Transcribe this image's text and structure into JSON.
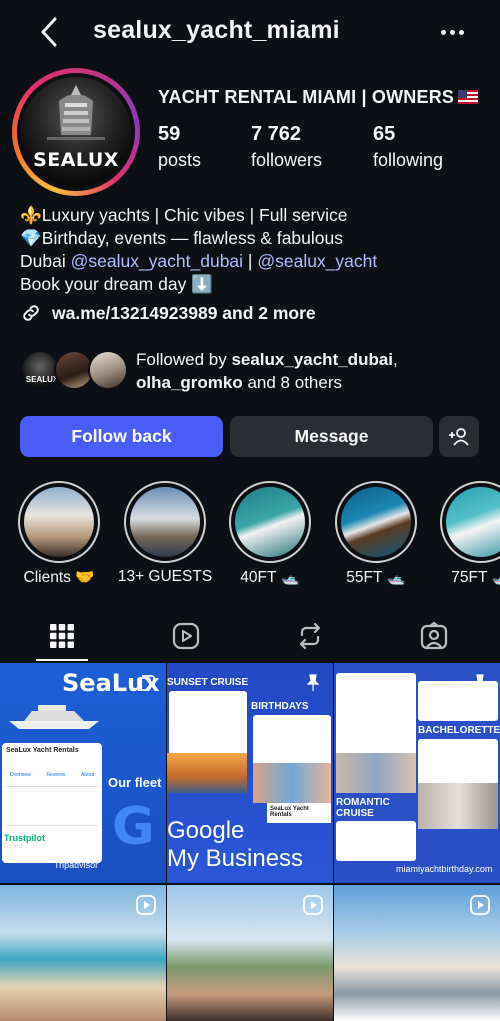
{
  "header": {
    "username": "sealux_yacht_miami",
    "back_icon": "chevron-left-icon",
    "more_icon": "more-horizontal-icon"
  },
  "profile": {
    "avatar_brand": "SEALUX",
    "category": "YACHT RENTAL MIAMI | OWNERS",
    "category_flag": "us-flag-icon",
    "stats": {
      "posts": {
        "value": "59",
        "label": "posts"
      },
      "followers": {
        "value": "7 762",
        "label": "followers"
      },
      "following": {
        "value": "65",
        "label": "following"
      }
    },
    "bio": {
      "line1": "⚜️Luxury yachts | Chic vibes | Full service",
      "line2": "💎Birthday, events — flawless & fabulous",
      "line3_prefix": "Dubai ",
      "mention1": "@sealux_yacht_dubai",
      "separator": " | ",
      "mention2": "@sealux_yacht",
      "line4": "Book your dream day ⬇️"
    },
    "link": "wa.me/13214923989 and 2 more"
  },
  "followed_by": {
    "prefix": "Followed by ",
    "user1": "sealux_yacht_dubai",
    "comma": ",",
    "user2": "olha_gromko",
    "suffix": " and 8 others",
    "avatar1_text": "SEALUX"
  },
  "actions": {
    "follow_back": "Follow back",
    "message": "Message",
    "add_user_icon": "add-person-icon"
  },
  "highlights": [
    {
      "label": "Clients 🤝"
    },
    {
      "label": "13+ GUESTS"
    },
    {
      "label": "40FT 🛥️"
    },
    {
      "label": "55FT 🛥️"
    },
    {
      "label": "75FT 🛥️"
    }
  ],
  "tabs": [
    {
      "name": "grid",
      "icon": "grid-icon",
      "active": true
    },
    {
      "name": "reels",
      "icon": "reels-icon"
    },
    {
      "name": "reposts",
      "icon": "repost-icon"
    },
    {
      "name": "tagged",
      "icon": "tagged-person-icon"
    }
  ],
  "posts": {
    "p1": {
      "brand": "SeaLux",
      "card_title": "SeaLux Yacht Rentals",
      "card_tabs": [
        "Overview",
        "Reviews",
        "About"
      ],
      "fleet_label": "Our fleet",
      "trustpilot": "Trustpilot",
      "rated": "Rated",
      "excellent": "Excellent.",
      "tripadvisor": "Tripadvisor"
    },
    "p2": {
      "sunset": "SUNSET CRUISE",
      "birthdays": "BIRTHDAYS",
      "google_line1": "Google",
      "google_line2": "My Business",
      "mini_card": "SeaLux Yacht Rentals"
    },
    "p3": {
      "bachelorette": "BACHELORETTE",
      "romantic_line1": "ROMANTIC",
      "romantic_line2": "CRUISE",
      "website": "miamiyachtbirthday.com"
    }
  },
  "colors": {
    "background": "#0c0f14",
    "primary_button": "#4a5df9",
    "secondary_button": "#2a2d33",
    "mention": "#aebcff",
    "promo_blue": "#1f4fd0"
  }
}
